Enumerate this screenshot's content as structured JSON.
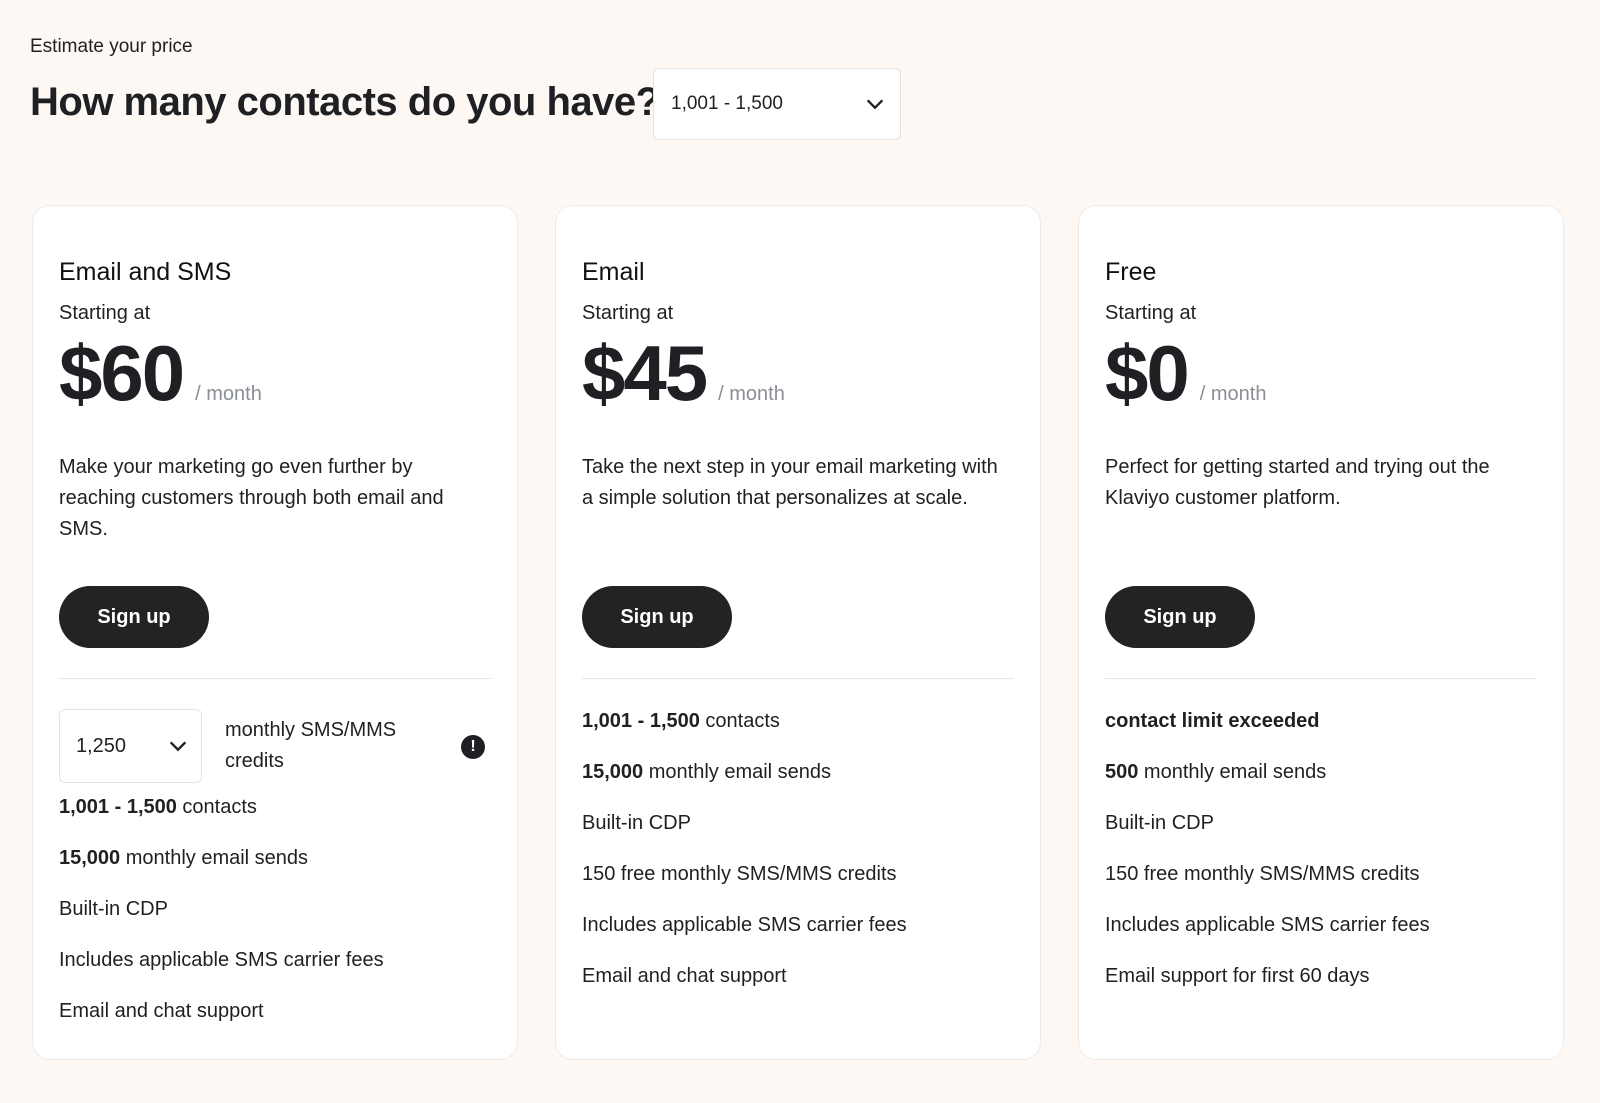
{
  "header": {
    "eyebrow": "Estimate your price",
    "title": "How many contacts do you have?",
    "contacts_select": {
      "value": "1,001 - 1,500",
      "icon": "chevron-down-icon"
    }
  },
  "plans": [
    {
      "name": "Email and SMS",
      "starting": "Starting at",
      "price": "$60",
      "period": "/ month",
      "description": "Make your marketing go even further by reaching customers through both email and SMS.",
      "cta": "Sign up",
      "sms_credits": {
        "value": "1,250",
        "label": "monthly SMS/MMS credits",
        "icon": "alert-info-icon"
      },
      "features": [
        {
          "bold": "1,001 - 1,500",
          "text": " contacts"
        },
        {
          "bold": "15,000",
          "text": " monthly email sends"
        },
        {
          "bold": "",
          "text": "Built-in CDP"
        },
        {
          "bold": "",
          "text": "Includes applicable SMS carrier fees"
        },
        {
          "bold": "",
          "text": "Email and chat support"
        }
      ]
    },
    {
      "name": "Email",
      "starting": "Starting at",
      "price": "$45",
      "period": "/ month",
      "description": "Take the next step in your email marketing with a simple solution that personalizes at scale.",
      "cta": "Sign up",
      "features": [
        {
          "bold": "1,001 - 1,500",
          "text": " contacts"
        },
        {
          "bold": "15,000",
          "text": " monthly email sends"
        },
        {
          "bold": "",
          "text": "Built-in CDP"
        },
        {
          "bold": "",
          "text": "150 free monthly SMS/MMS credits"
        },
        {
          "bold": "",
          "text": "Includes applicable SMS carrier fees"
        },
        {
          "bold": "",
          "text": "Email and chat support"
        }
      ]
    },
    {
      "name": "Free",
      "starting": "Starting at",
      "price": "$0",
      "period": "/ month",
      "description": "Perfect for getting started and trying out the Klaviyo customer platform.",
      "cta": "Sign up",
      "features": [
        {
          "bold": "contact limit exceeded",
          "text": ""
        },
        {
          "bold": "500",
          "text": " monthly email sends"
        },
        {
          "bold": "",
          "text": "Built-in CDP"
        },
        {
          "bold": "",
          "text": "150 free monthly SMS/MMS credits"
        },
        {
          "bold": "",
          "text": "Includes applicable SMS carrier fees"
        },
        {
          "bold": "",
          "text": "Email support for first 60 days"
        }
      ]
    }
  ]
}
